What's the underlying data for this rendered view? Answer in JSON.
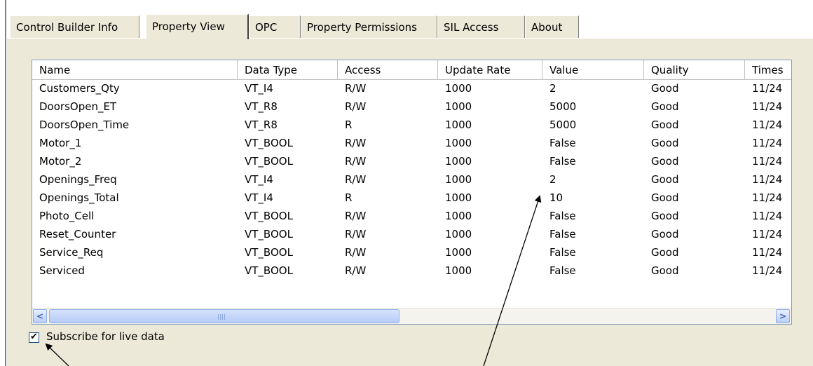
{
  "tabs": [
    {
      "label": "Control Builder Info",
      "active": false
    },
    {
      "label": "Property View",
      "active": true
    },
    {
      "label": "OPC",
      "active": false
    },
    {
      "label": "Property Permissions",
      "active": false
    },
    {
      "label": "SIL Access",
      "active": false
    },
    {
      "label": "About",
      "active": false
    }
  ],
  "table": {
    "columns": [
      "Name",
      "Data Type",
      "Access",
      "Update Rate",
      "Value",
      "Quality",
      "Times"
    ],
    "rows": [
      [
        "Customers_Qty",
        "VT_I4",
        "R/W",
        "1000",
        "2",
        "Good",
        "11/24"
      ],
      [
        "DoorsOpen_ET",
        "VT_R8",
        "R/W",
        "1000",
        "5000",
        "Good",
        "11/24"
      ],
      [
        "DoorsOpen_Time",
        "VT_R8",
        "R",
        "1000",
        "5000",
        "Good",
        "11/24"
      ],
      [
        "Motor_1",
        "VT_BOOL",
        "R/W",
        "1000",
        "False",
        "Good",
        "11/24"
      ],
      [
        "Motor_2",
        "VT_BOOL",
        "R/W",
        "1000",
        "False",
        "Good",
        "11/24"
      ],
      [
        "Openings_Freq",
        "VT_I4",
        "R/W",
        "1000",
        "2",
        "Good",
        "11/24"
      ],
      [
        "Openings_Total",
        "VT_I4",
        "R",
        "1000",
        "10",
        "Good",
        "11/24"
      ],
      [
        "Photo_Cell",
        "VT_BOOL",
        "R/W",
        "1000",
        "False",
        "Good",
        "11/24"
      ],
      [
        "Reset_Counter",
        "VT_BOOL",
        "R/W",
        "1000",
        "False",
        "Good",
        "11/24"
      ],
      [
        "Service_Req",
        "VT_BOOL",
        "R/W",
        "1000",
        "False",
        "Good",
        "11/24"
      ],
      [
        "Serviced",
        "VT_BOOL",
        "R/W",
        "1000",
        "False",
        "Good",
        "11/24"
      ]
    ]
  },
  "scrollbar": {
    "left_icon": "scroll-left-arrow-icon",
    "right_icon": "scroll-right-arrow-icon",
    "left_glyph": "<",
    "right_glyph": ">"
  },
  "subscribe": {
    "label": "Subscribe for live data",
    "checked": true,
    "check_glyph": "✔"
  },
  "colors": {
    "panel_bg": "#ece9d8",
    "list_border": "#7f9db9",
    "scroll_thumb": "#b6cbf7"
  }
}
